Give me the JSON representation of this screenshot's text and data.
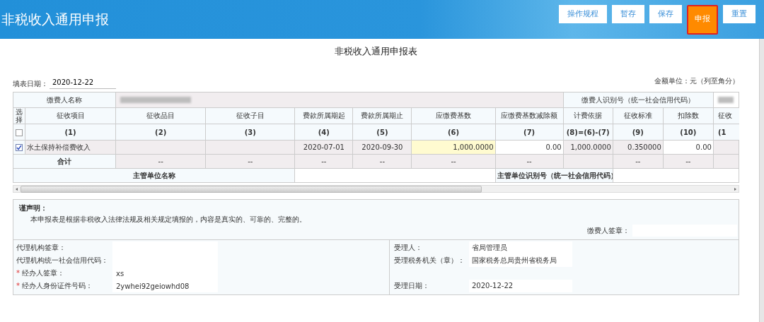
{
  "header": {
    "title": "非税收入通用申报",
    "buttons": [
      {
        "label": "操作规程",
        "selected": false
      },
      {
        "label": "暂存",
        "selected": false
      },
      {
        "label": "保存",
        "selected": false
      },
      {
        "label": "申报",
        "selected": true
      },
      {
        "label": "重置",
        "selected": false
      }
    ]
  },
  "form": {
    "title": "非税收入通用申报表",
    "fill_date_label": "填表日期：",
    "fill_date_value": "2020-12-22",
    "unit_note": "金额单位：元（列至角分）"
  },
  "table": {
    "payer_name_label": "缴费人名称",
    "payer_id_label": "缴费人识别号（统一社会信用代码）",
    "select_label": "选择",
    "select_all_checked": false,
    "columns": [
      {
        "label": "征收项目",
        "index": "(1)"
      },
      {
        "label": "征收品目",
        "index": "(2)"
      },
      {
        "label": "征收子目",
        "index": "(3)"
      },
      {
        "label": "费款所属期起",
        "index": "(4)"
      },
      {
        "label": "费款所属期止",
        "index": "(5)"
      },
      {
        "label": "应缴费基数",
        "index": "(6)"
      },
      {
        "label": "应缴费基数减除额",
        "index": "(7)"
      },
      {
        "label": "计费依据",
        "index": "(8)=(6)-(7)"
      },
      {
        "label": "征收标准",
        "index": "(9)"
      },
      {
        "label": "扣除数",
        "index": "(10)"
      },
      {
        "label": "征收",
        "index": "(1"
      }
    ],
    "rows": [
      {
        "checked": true,
        "cells": [
          {
            "kind": "text",
            "value": "水土保持补偿费收入"
          },
          {
            "kind": "text"
          },
          {
            "kind": "text"
          },
          {
            "kind": "text",
            "value": "2020-07-01"
          },
          {
            "kind": "text",
            "value": "2020-09-30"
          },
          {
            "kind": "highlight",
            "value": "1,000.0000"
          },
          {
            "kind": "input",
            "value": "0.00"
          },
          {
            "kind": "number",
            "value": "1,000.0000"
          },
          {
            "kind": "number",
            "value": "0.350000"
          },
          {
            "kind": "input",
            "value": "0.00"
          },
          {
            "kind": "text"
          }
        ]
      }
    ],
    "total": {
      "label": "合计",
      "values": [
        {
          "kind": "dash",
          "value": "--"
        },
        {
          "kind": "dash",
          "value": "--"
        },
        {
          "kind": "dash",
          "value": "--"
        },
        {
          "kind": "dash",
          "value": "--"
        },
        {
          "kind": "dash",
          "value": "--"
        },
        {
          "kind": "dash",
          "value": "--"
        },
        {
          "kind": "blank"
        },
        {
          "kind": "dash",
          "value": "--"
        },
        {
          "kind": "dash",
          "value": "--"
        },
        {
          "kind": "blank"
        }
      ]
    },
    "supervisor_name_label": "主管单位名称",
    "supervisor_id_label": "主管单位识别号（统一社会信用代码）"
  },
  "declaration": {
    "title": "谨声明：",
    "text": "本申报表是根据非税收入法律法规及相关规定填报的，内容是真实的、可靠的、完整的。",
    "payer_sign_label": "缴费人签章："
  },
  "left_fields": [
    {
      "label": "代理机构签章："
    },
    {
      "label": "代理机构统一社会信用代码："
    },
    {
      "required_mark": "*",
      "label": "经办人签章：",
      "value": "xs"
    },
    {
      "required_mark": "*",
      "label": "经办人身份证件号码：",
      "value": "2ywhei92geiowhd08"
    }
  ],
  "right_fields": [
    {
      "label": "受理人：",
      "value": "省局管理员"
    },
    {
      "label": "受理税务机关（章）：",
      "value": "国家税务总局贵州省税务局"
    },
    {
      "label": "受理日期：",
      "value": "2020-12-22"
    }
  ]
}
